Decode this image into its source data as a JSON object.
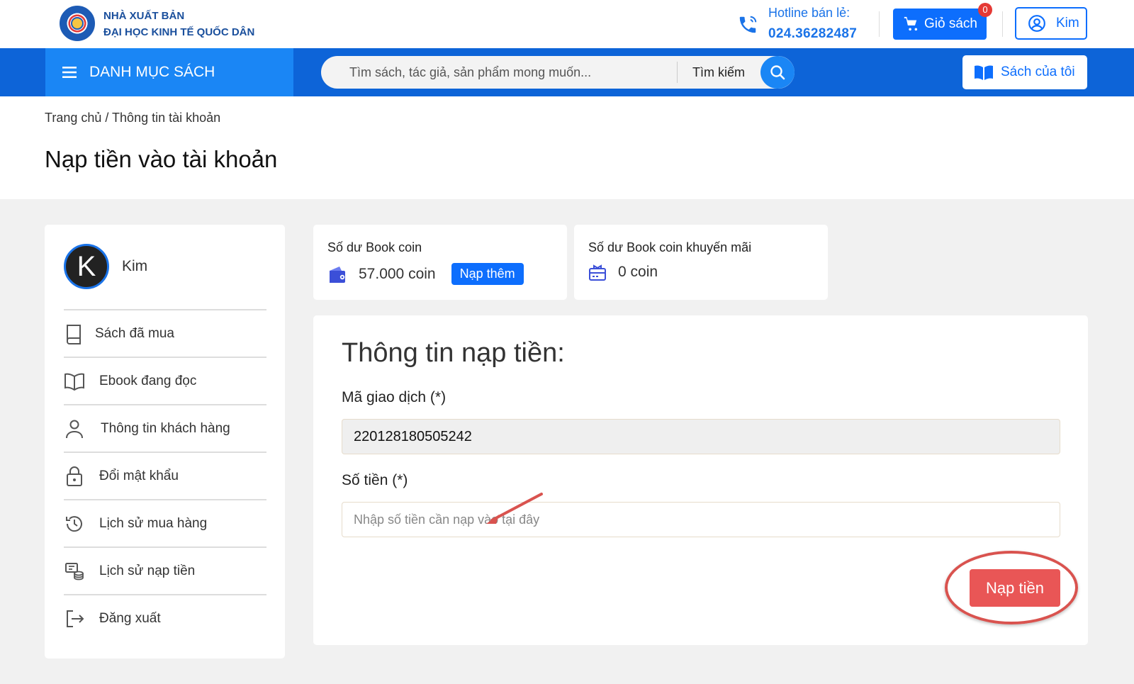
{
  "header": {
    "brand_line1": "NHÀ XUẤT BẢN",
    "brand_line2": "ĐẠI HỌC KINH TẾ QUỐC DÂN",
    "hotline_label": "Hotline bán lẻ:",
    "hotline_number": "024.36282487",
    "cart_label": "Giỏ sách",
    "cart_count": "0",
    "user_label": "Kim"
  },
  "nav": {
    "category_label": "DANH MỤC SÁCH",
    "search_placeholder": "Tìm sách, tác giả, sản phẩm mong muốn...",
    "search_button_label": "Tìm kiếm",
    "my_books_label": "Sách của tôi"
  },
  "breadcrumb": "Trang chủ / Thông tin tài khoản",
  "page_title": "Nạp tiền vào tài khoản",
  "sidebar": {
    "avatar_letter": "K",
    "user_name": "Kim",
    "items": [
      {
        "label": "Sách đã mua",
        "icon": "book-icon"
      },
      {
        "label": "Ebook đang đọc",
        "icon": "open-book-icon"
      },
      {
        "label": "Thông tin khách hàng",
        "icon": "user-icon"
      },
      {
        "label": "Đổi mật khẩu",
        "icon": "lock-icon"
      },
      {
        "label": "Lịch sử mua hàng",
        "icon": "history-icon"
      },
      {
        "label": "Lịch sử nạp tiền",
        "icon": "topup-history-icon"
      },
      {
        "label": "Đăng xuất",
        "icon": "logout-icon"
      }
    ]
  },
  "balance": {
    "main_title": "Số dư Book coin",
    "main_value": "57.000 coin",
    "topup_label": "Nạp thêm",
    "promo_title": "Số dư Book coin khuyến mãi",
    "promo_value": "0 coin"
  },
  "form": {
    "title": "Thông tin nạp tiền:",
    "transaction_label": "Mã giao dịch (*)",
    "transaction_value": "220128180505242",
    "amount_label": "Số tiền (*)",
    "amount_placeholder": "Nhập số tiền cần nạp vào tại đây",
    "submit_label": "Nạp tiền"
  },
  "colors": {
    "primary": "#0d6efd",
    "nav_bg": "#0d64d8",
    "category_bg": "#1a86f5",
    "submit": "#e95656",
    "annotation": "#d9534f"
  }
}
